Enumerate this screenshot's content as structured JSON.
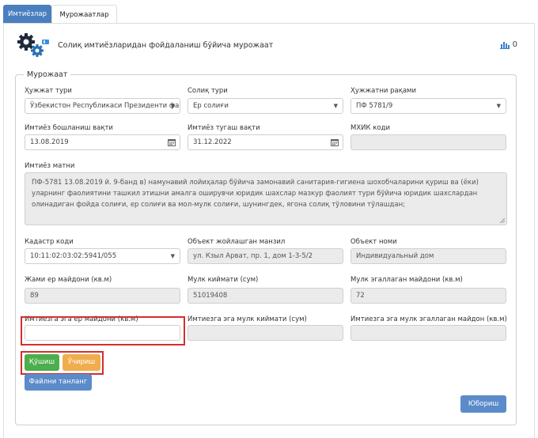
{
  "tabs": [
    {
      "label": "Имтиёзлар"
    },
    {
      "label": "Мурожаатлар"
    }
  ],
  "header": {
    "title": "Солиқ имтиёзларидан фойдаланиш бўйича мурожаат",
    "stats_count": "0"
  },
  "form": {
    "legend": "Мурожаат",
    "doc_type": {
      "label": "Ҳужжат тури",
      "value": "Ўзбекистон Республикаси Президенти фар"
    },
    "tax_type": {
      "label": "Солиқ тури",
      "value": "Ер солиғи"
    },
    "doc_number": {
      "label": "Ҳужжатни рақами",
      "value": "ПФ 5781/9"
    },
    "start_date": {
      "label": "Имтиёз бошланиш вақти",
      "value": "13.08.2019"
    },
    "end_date": {
      "label": "Имтиёз тугаш вақти",
      "value": "31.12.2022"
    },
    "mxik": {
      "label": "МХИК коди",
      "value": ""
    },
    "text": {
      "label": "Имтиёз матни",
      "value": "ПФ-5781 13.08.2019 й. 9-банд в) намунавий лойиҳалар бўйича замонавий санитария-гигиена шохобчаларини қуриш ва (ёки) уларнинг фаолиятини ташкил этишни амалга оширувчи юридик шахслар мазкур фаолият тури бўйича юридик шахслардан олинадиган фойда солиғи, ер солиғи ва мол-мулк солиғи, шунингдек, ягона солиқ тўловини тўлашдан;"
    },
    "cadastre": {
      "label": "Кадастр коди",
      "value": "10:11:02:03:02:5941/055"
    },
    "address": {
      "label": "Объект жойлашган манзил",
      "value": "ул. Кзыл Арват, пр. 1, дом 1-3-5/2"
    },
    "object_name": {
      "label": "Объект номи",
      "value": "Индивидуальный дом"
    },
    "land_area": {
      "label": "Жами ер майдони (кв.м)",
      "value": "89"
    },
    "property_value": {
      "label": "Мулк киймати (сум)",
      "value": "51019408"
    },
    "occupied_area": {
      "label": "Мулк эгаллаган майдони (кв.м)",
      "value": "72"
    },
    "benefit_land_area": {
      "label": "Имтиезга эга ер майдони (кв.м)",
      "value": ""
    },
    "benefit_property_value": {
      "label": "Имтиезга эга мулк киймати (сум)",
      "value": ""
    },
    "benefit_occupied_area": {
      "label": "Имтиезга эга мулк эгаллаган майдон (кв.м)",
      "value": ""
    }
  },
  "buttons": {
    "add": "Қўшиш",
    "remove": "Ўчириш",
    "choose_file": "Файлни танланг",
    "send": "Юбориш"
  },
  "colors": {
    "primary": "#5b8bc9",
    "success": "#4cae4c",
    "warning": "#f0ad4e",
    "highlight": "#d42e2e"
  }
}
